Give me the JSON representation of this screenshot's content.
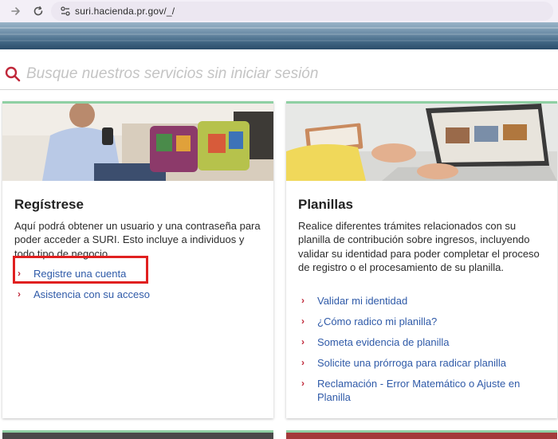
{
  "browser": {
    "url": "suri.hacienda.pr.gov/_/",
    "icons": [
      "forward-arrow-icon",
      "reload-icon",
      "site-settings-icon"
    ]
  },
  "search": {
    "placeholder": "Busque nuestros servicios sin iniciar sesión",
    "icon": "search-icon"
  },
  "cards": [
    {
      "title": "Regístrese",
      "description": "Aquí podrá obtener un usuario y una contraseña para poder acceder a SURI. Esto incluye a individuos y todo tipo de negocio.",
      "links": [
        "Registre una cuenta",
        "Asistencia con su acceso"
      ]
    },
    {
      "title": "Planillas",
      "description": "Realice diferentes trámites relacionados con su planilla de contribución sobre ingresos, incluyendo validar su identidad para poder completar el proceso de registro o el procesamiento de su planilla.",
      "links": [
        "Validar mi identidad",
        "¿Cómo radico mi planilla?",
        "Someta evidencia de planilla",
        "Solicite una prórroga para radicar planilla",
        "Reclamación - Error Matemático o Ajuste en Planilla"
      ]
    }
  ],
  "colors": {
    "accent_green": "#8fd0a3",
    "link_blue": "#2f5aa8",
    "chevron_red": "#c0283a",
    "highlight_red": "#e02020"
  }
}
